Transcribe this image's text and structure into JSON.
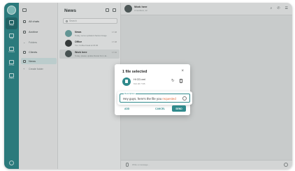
{
  "rail": {
    "items": [
      {
        "label": "Chats",
        "active": true
      },
      {
        "label": "Calls",
        "active": false
      },
      {
        "label": "Contacts",
        "active": false
      },
      {
        "label": "Archive",
        "active": false
      },
      {
        "label": "Folders",
        "active": false
      }
    ]
  },
  "folders": {
    "items": [
      {
        "label": "All chats"
      },
      {
        "label": "Archive"
      },
      {
        "label": "Folders"
      },
      {
        "label": "Clients"
      },
      {
        "label": "News"
      },
      {
        "label": "Create folder"
      }
    ]
  },
  "list": {
    "title": "News",
    "search_placeholder": "Search",
    "chats": [
      {
        "name": "News",
        "time": "17:08",
        "preview": "Today, we've updated channel image"
      },
      {
        "name": "Office",
        "time": "17:08",
        "preview": "You: Coffee break at 15:00"
      },
      {
        "name": "Work here",
        "time": "17:02",
        "preview": "Today, please update Daniel from Ja..."
      }
    ]
  },
  "conversation": {
    "name": "Work here",
    "subtitle": "4 members, 12",
    "input_placeholder": "Write a message..."
  },
  "dialog": {
    "title": "1 file selected",
    "close": "×",
    "file_name": "Hi CD.xml",
    "file_size": "612.46 7 KB",
    "description_label": "Description",
    "description_text": "Hey guys, here's the file you ",
    "description_highlight": "requested",
    "add": "ADD",
    "cancel": "CANCEL",
    "send": "SEND"
  },
  "colors": {
    "accent": "#2f8a8c",
    "highlight": "#e06a3a"
  }
}
